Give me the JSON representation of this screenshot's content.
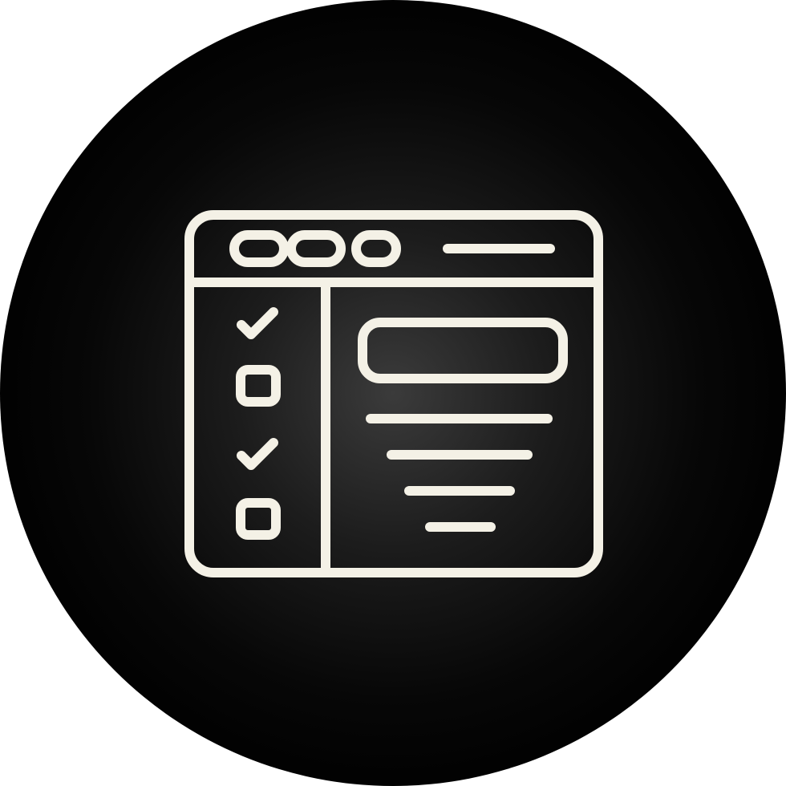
{
  "icon": {
    "name": "checklist-window-icon",
    "stroke_color": "#f4f1e6",
    "background_color": "#000000",
    "page_background": "#ffffff"
  },
  "window": {
    "titlebar_buttons": [
      "circle",
      "circle",
      "circle"
    ],
    "sidebar_items": [
      {
        "state": "checked"
      },
      {
        "state": "unchecked"
      },
      {
        "state": "checked"
      },
      {
        "state": "unchecked"
      }
    ],
    "content_lines": 4
  }
}
